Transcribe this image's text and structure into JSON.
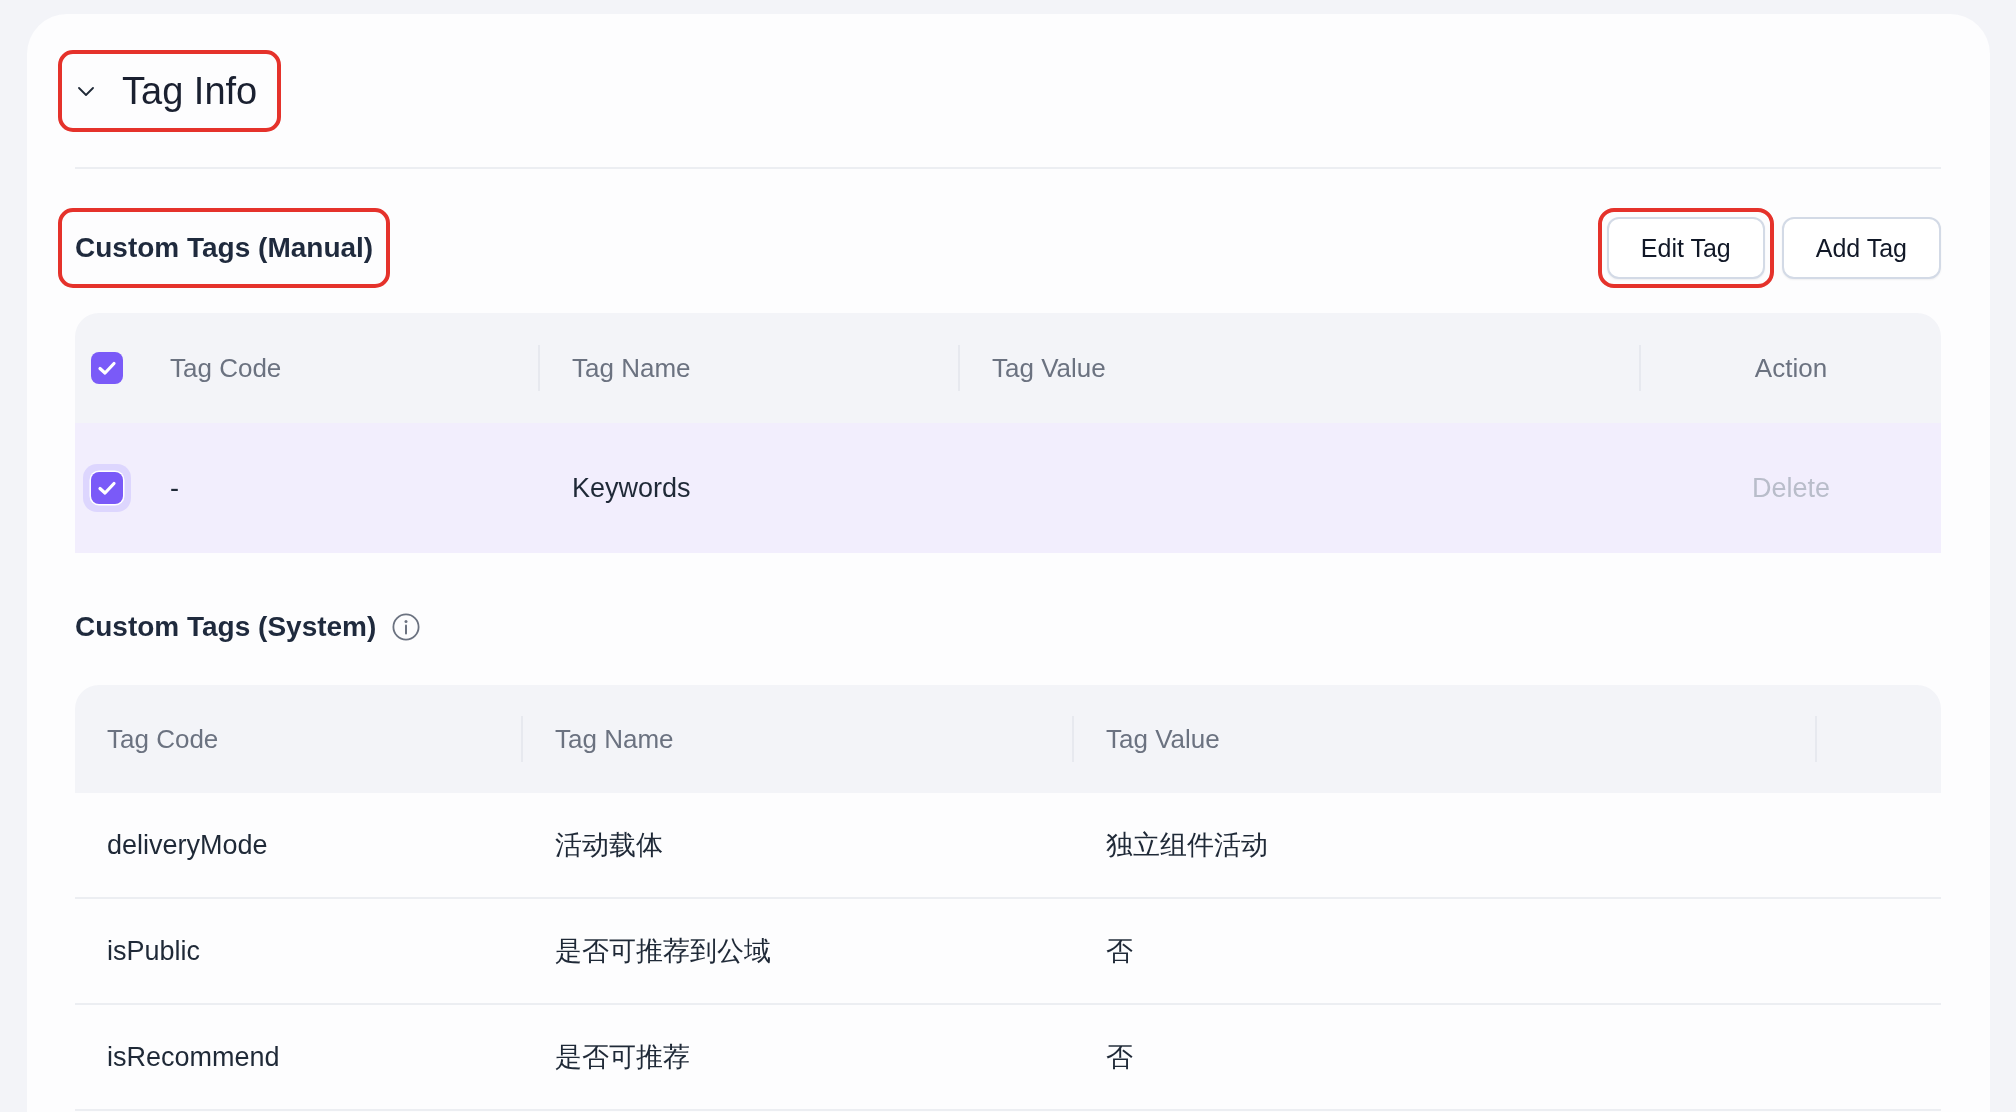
{
  "section": {
    "title": "Tag Info",
    "expanded": true,
    "highlighted": true
  },
  "manual_tags": {
    "title": "Custom Tags (Manual)",
    "highlighted": true,
    "buttons": [
      {
        "label": "Edit Tag",
        "highlighted": true
      },
      {
        "label": "Add Tag",
        "highlighted": false
      }
    ],
    "table": {
      "select_all": {
        "checked": true
      },
      "columns": [
        "Tag Code",
        "Tag Name",
        "Tag Value",
        "Action"
      ],
      "rows": [
        {
          "selected": true,
          "checked": true,
          "focused": true,
          "tag_code": "-",
          "tag_name": "Keywords",
          "action": {
            "label": "Delete",
            "disabled": true
          }
        }
      ]
    }
  },
  "system_tags": {
    "title": "Custom Tags (System)",
    "columns": [
      "Tag Code",
      "Tag Name",
      "Tag Value"
    ],
    "rows": [
      {
        "tag_code": "deliveryMode",
        "tag_name": "活动载体",
        "tag_value": "独立组件活动"
      },
      {
        "tag_code": "isPublic",
        "tag_name": "是否可推荐到公域",
        "tag_value": "否"
      },
      {
        "tag_code": "isRecommend",
        "tag_name": "是否可推荐",
        "tag_value": "否"
      }
    ]
  }
}
